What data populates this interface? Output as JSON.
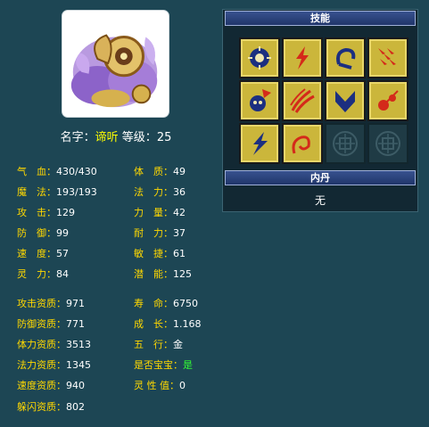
{
  "profile": {
    "name_label": "名字：",
    "name": "谛听",
    "level_label": "等级：",
    "level": "25"
  },
  "stats_left": [
    {
      "label": "气　血：",
      "value": "430/430"
    },
    {
      "label": "魔　法：",
      "value": "193/193"
    },
    {
      "label": "攻　击：",
      "value": "129"
    },
    {
      "label": "防　御：",
      "value": "99"
    },
    {
      "label": "速　度：",
      "value": "57"
    },
    {
      "label": "灵　力：",
      "value": "84"
    }
  ],
  "stats_right": [
    {
      "label": "体　质：",
      "value": "49"
    },
    {
      "label": "法　力：",
      "value": "36"
    },
    {
      "label": "力　量：",
      "value": "42"
    },
    {
      "label": "耐　力：",
      "value": "37"
    },
    {
      "label": "敏　捷：",
      "value": "61"
    },
    {
      "label": "潜　能：",
      "value": "125"
    }
  ],
  "aptitudes_left": [
    {
      "label": "攻击资质：",
      "value": "971"
    },
    {
      "label": "防御资质：",
      "value": "771"
    },
    {
      "label": "体力资质：",
      "value": "3513"
    },
    {
      "label": "法力资质：",
      "value": "1345"
    },
    {
      "label": "速度资质：",
      "value": "940"
    },
    {
      "label": "躲闪资质：",
      "value": "802"
    }
  ],
  "aptitudes_right": [
    {
      "label": "寿　命：",
      "value": "6750"
    },
    {
      "label": "成　长：",
      "value": "1.168"
    },
    {
      "label": "五　行：",
      "value": "金"
    },
    {
      "label": "是否宝宝：",
      "value": "是"
    },
    {
      "label": "灵 性 值：",
      "value": "0"
    }
  ],
  "skills_panel": {
    "title": "技能",
    "icons": [
      "sun-seal-icon",
      "lightning-scroll-icon",
      "hook-icon",
      "arrow-rain-icon",
      "skull-strike-icon",
      "fire-claw-icon",
      "shield-wing-icon",
      "meteor-icon",
      "thunder-icon",
      "flame-swirl-icon",
      "empty-slot-icon",
      "empty-slot-icon"
    ],
    "neidan_title": "内丹",
    "neidan_value": "无"
  },
  "colors": {
    "background": "#1d4654",
    "label": "#ffd800",
    "value": "#ffffff",
    "highlight": "#ffff00",
    "yes": "#33ff33"
  }
}
